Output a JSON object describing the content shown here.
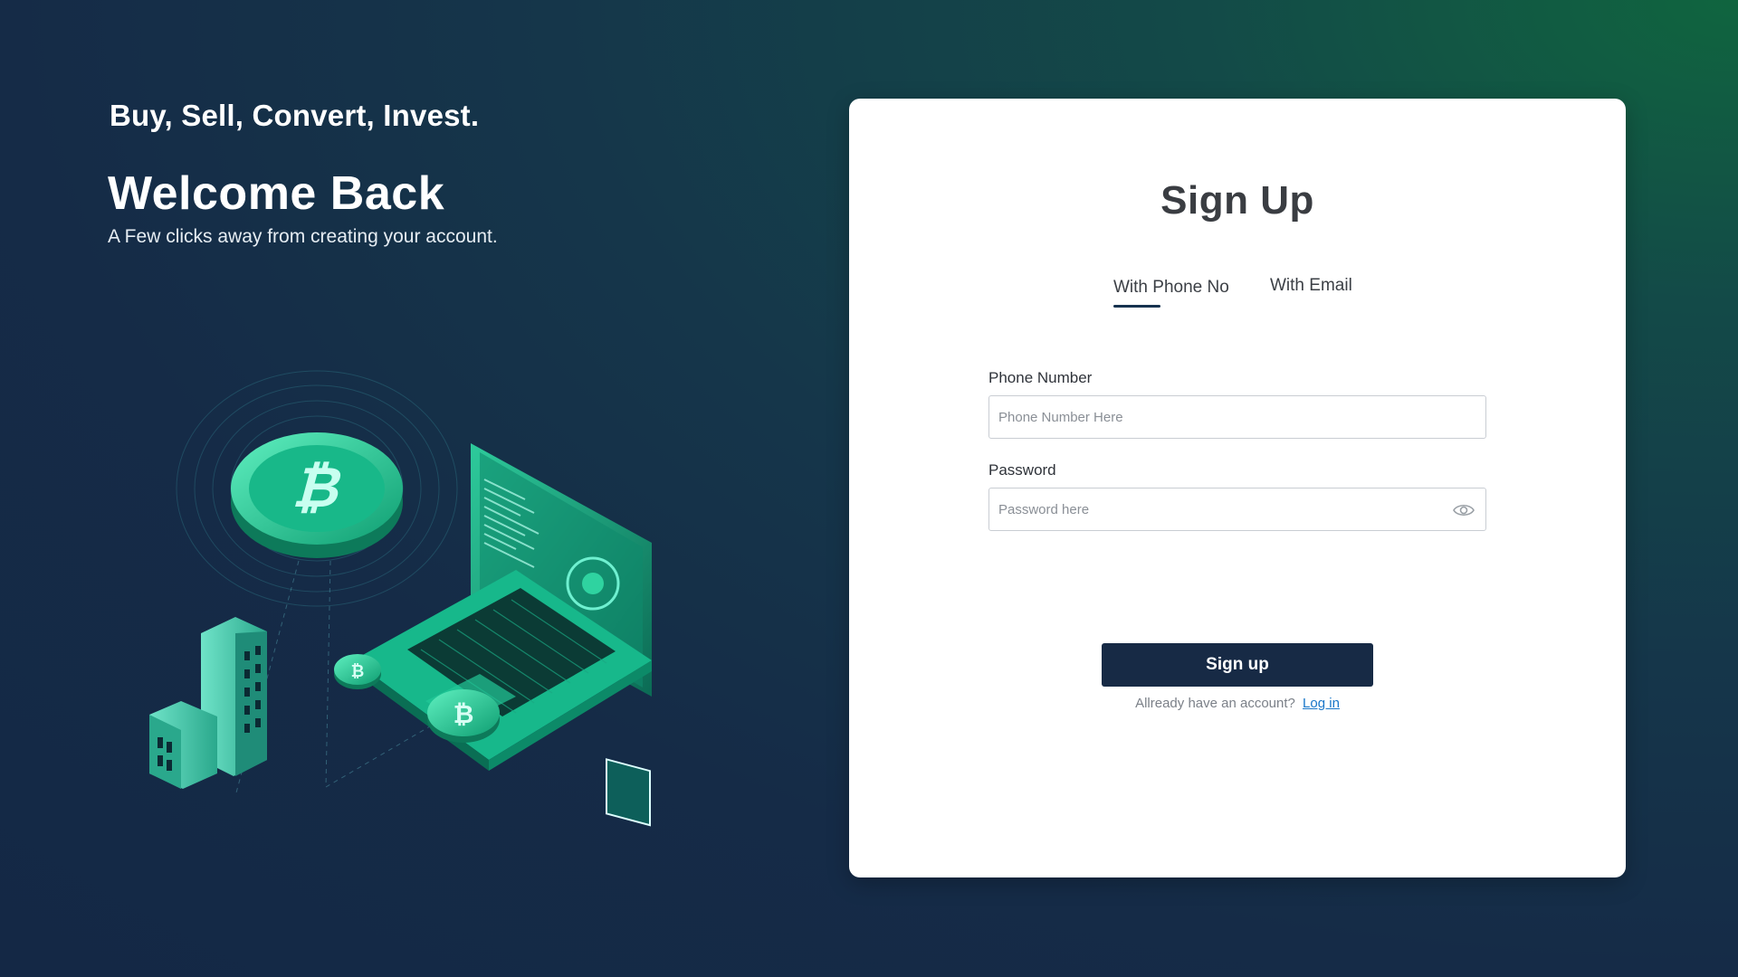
{
  "hero": {
    "tagline": "Buy, Sell, Convert, Invest.",
    "title": "Welcome Back",
    "subtitle": "A Few clicks away from creating your account."
  },
  "form": {
    "title": "Sign Up",
    "tabs": [
      {
        "label": "With Phone No",
        "active": true
      },
      {
        "label": "With Email",
        "active": false
      }
    ],
    "phone": {
      "label": "Phone Number",
      "placeholder": "Phone Number Here",
      "value": ""
    },
    "password": {
      "label": "Password",
      "placeholder": "Password here",
      "value": "",
      "toggle_icon": "eye-icon"
    },
    "submit_label": "Sign up",
    "login_prompt": "Allready have an account?",
    "login_link": "Log in"
  },
  "colors": {
    "primary_button": "#172a45",
    "link": "#1976c9",
    "accent_green": "#2fd3a0"
  }
}
